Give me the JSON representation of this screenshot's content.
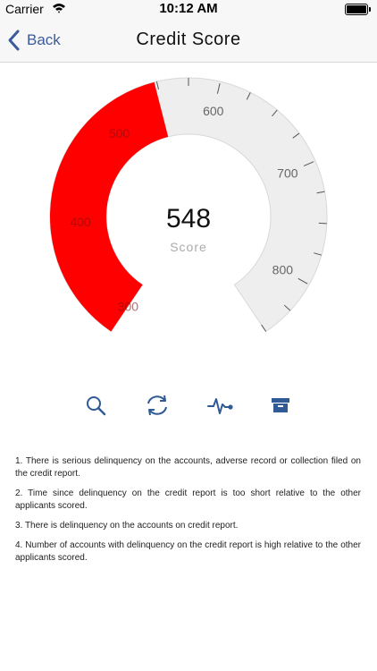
{
  "status_bar": {
    "carrier": "Carrier",
    "time": "10:12 AM"
  },
  "nav": {
    "back_label": "Back",
    "title": "Credit Score"
  },
  "gauge": {
    "score": "548",
    "score_label": "Score",
    "tick_labels": [
      "300",
      "400",
      "500",
      "600",
      "700",
      "800"
    ],
    "min": 300,
    "max": 850,
    "value": 548,
    "fill_color": "#ff0000",
    "track_color": "#eeeeee"
  },
  "toolbar": {
    "icons": [
      "search-icon",
      "refresh-icon",
      "activity-icon",
      "archive-icon"
    ],
    "accent_color": "#2f5a96"
  },
  "notes": [
    "1. There is serious delinquency on the accounts, adverse record or collection filed on the credit report.",
    "2. Time since delinquency on the credit report is too short relative to the other applicants scored.",
    "3. There is delinquency on the accounts on credit report.",
    "4. Number of accounts with delinquency on the credit report is high relative to the other applicants scored."
  ]
}
